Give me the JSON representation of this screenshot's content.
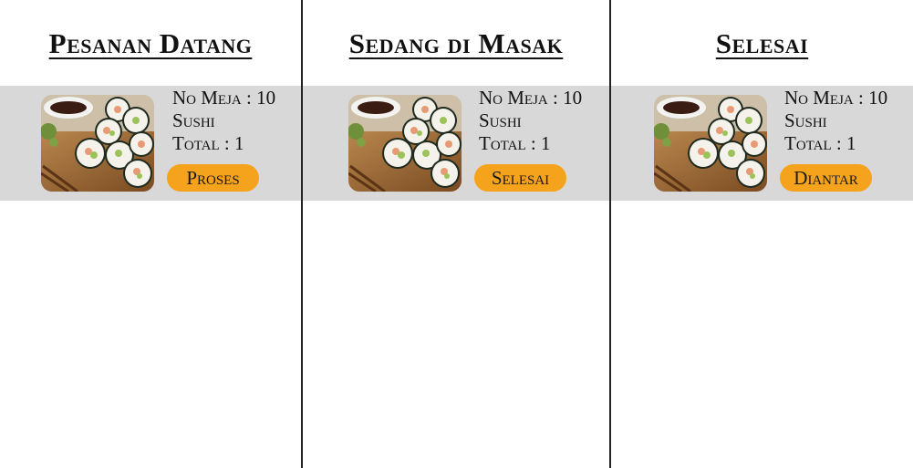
{
  "columns": [
    {
      "title": "Pesanan Datang",
      "order": {
        "table_label": "No Meja",
        "table_number": "10",
        "item_name": "Sushi",
        "total_label": "Total",
        "total_value": "1",
        "action_label": "Proses",
        "image": "sushi-photo"
      }
    },
    {
      "title": "Sedang di Masak",
      "order": {
        "table_label": "No Meja",
        "table_number": "10",
        "item_name": "Sushi",
        "total_label": "Total",
        "total_value": "1",
        "action_label": "Selesai",
        "image": "sushi-photo"
      }
    },
    {
      "title": "Selesai",
      "order": {
        "table_label": "No Meja",
        "table_number": "10",
        "item_name": "Sushi",
        "total_label": "Total",
        "total_value": "1",
        "action_label": "Diantar",
        "image": "sushi-photo"
      }
    }
  ],
  "colors": {
    "card_background": "#d8d8d8",
    "button_accent": "#f5a21c",
    "divider": "#222222"
  }
}
